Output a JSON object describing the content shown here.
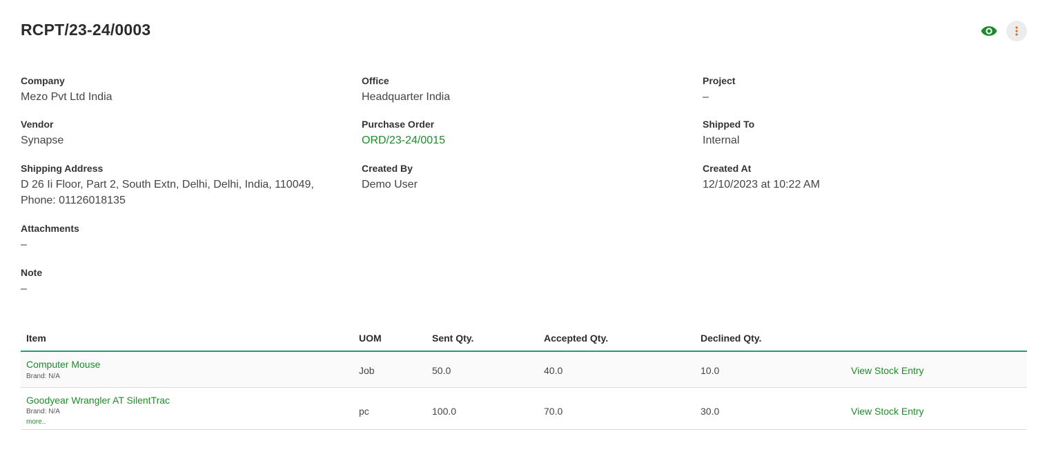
{
  "header": {
    "title": "RCPT/23-24/0003",
    "accent_color": "#1f8a2a",
    "icons": {
      "view": "eye-icon",
      "more": "more-vertical-icon"
    }
  },
  "fields": {
    "company": {
      "label": "Company",
      "value": "Mezo Pvt Ltd India"
    },
    "office": {
      "label": "Office",
      "value": "Headquarter India"
    },
    "project": {
      "label": "Project",
      "value": "–"
    },
    "vendor": {
      "label": "Vendor",
      "value": "Synapse"
    },
    "purchase_order": {
      "label": "Purchase Order",
      "value": "ORD/23-24/0015"
    },
    "shipped_to": {
      "label": "Shipped To",
      "value": "Internal"
    },
    "shipping_address": {
      "label": "Shipping Address",
      "value": "D 26 Ii Floor, Part 2, South Extn, Delhi, Delhi, India, 110049,",
      "phone": "Phone: 01126018135"
    },
    "created_by": {
      "label": "Created By",
      "value": "Demo User"
    },
    "created_at": {
      "label": "Created At",
      "value": "12/10/2023 at 10:22 AM"
    },
    "attachments": {
      "label": "Attachments",
      "value": "–"
    },
    "note": {
      "label": "Note",
      "value": "–"
    }
  },
  "table": {
    "columns": [
      "Item",
      "UOM",
      "Sent Qty.",
      "Accepted Qty.",
      "Declined Qty."
    ],
    "rows": [
      {
        "item": "Computer Mouse",
        "brand": "Brand: N/A",
        "uom": "Job",
        "sent": "50.0",
        "accepted": "40.0",
        "declined": "10.0",
        "action": "View Stock Entry"
      },
      {
        "item": "Goodyear Wrangler AT SilentTrac",
        "brand": "Brand: N/A",
        "more": "more..",
        "uom": "pc",
        "sent": "100.0",
        "accepted": "70.0",
        "declined": "30.0",
        "action": "View Stock Entry"
      }
    ]
  }
}
